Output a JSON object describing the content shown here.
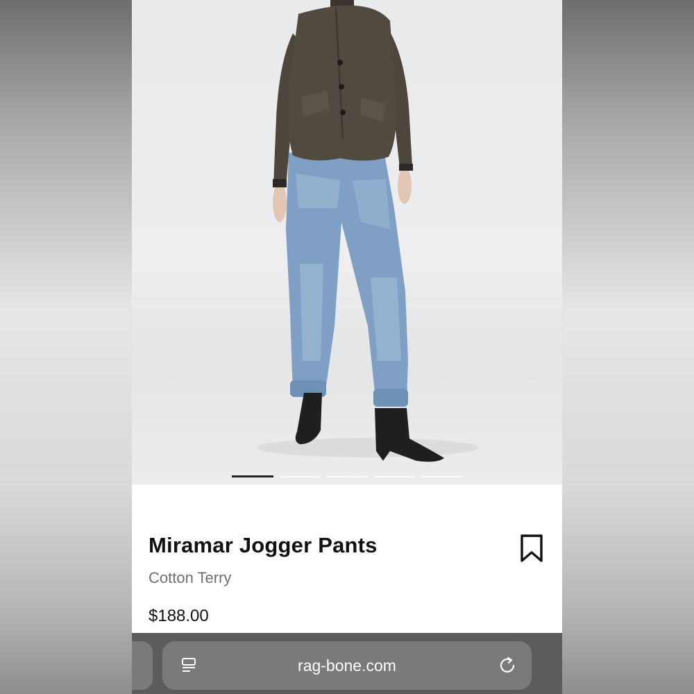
{
  "product": {
    "title": "Miramar Jogger Pants",
    "subtitle": "Cotton Terry",
    "price": "$188.00"
  },
  "gallery": {
    "image_count": 5,
    "active_index": 0
  },
  "browser": {
    "url": "rag-bone.com"
  },
  "icons": {
    "bookmark": "bookmark-icon",
    "reader": "reader-mode-icon",
    "reload": "reload-icon"
  },
  "colors": {
    "background": "#ffffff",
    "text": "#111111",
    "subtitle": "#6f6f6f",
    "browser_bar": "#5c5c5c",
    "url_pill": "#7a7a7a"
  }
}
